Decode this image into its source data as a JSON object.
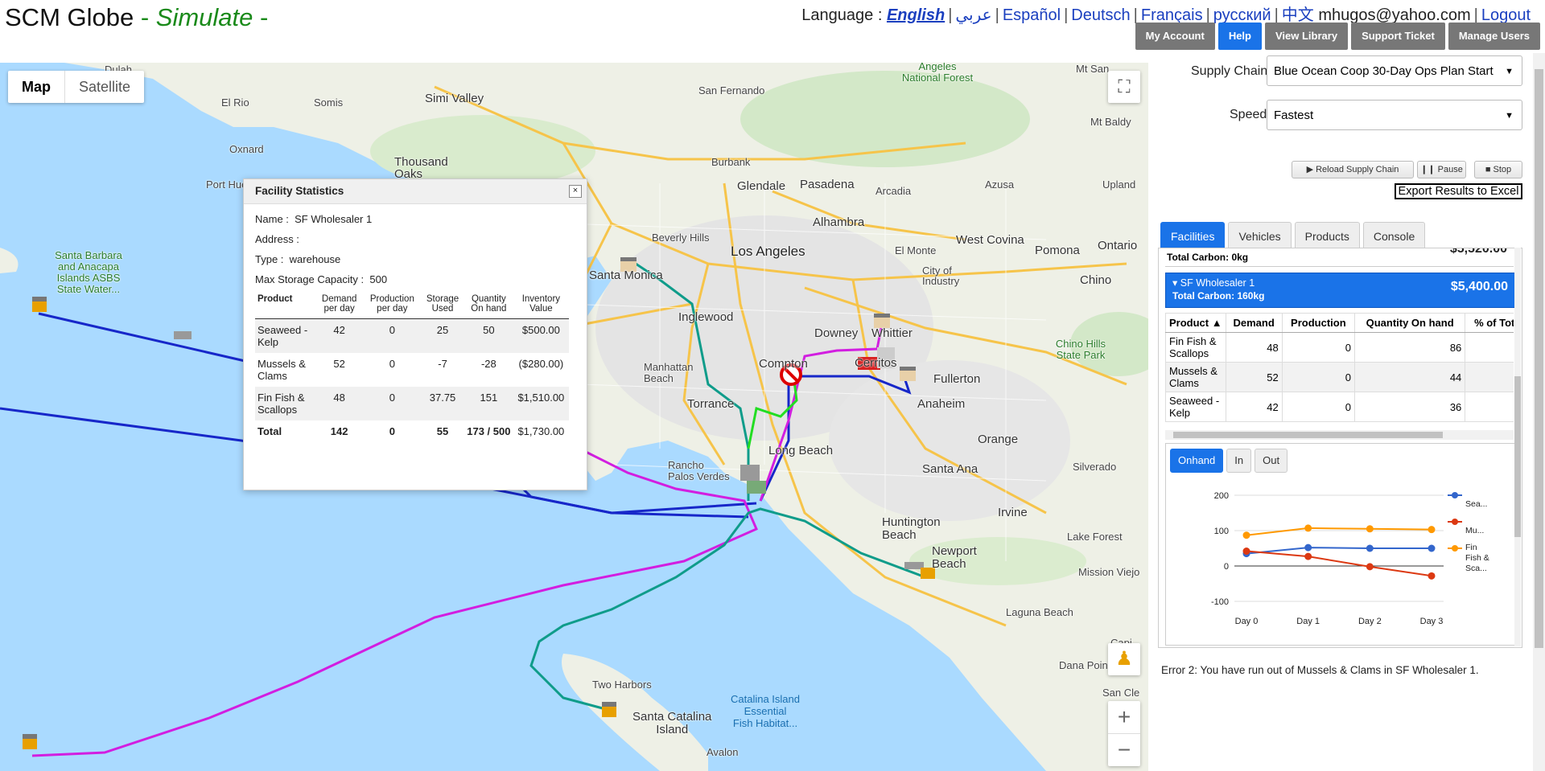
{
  "header": {
    "app_name": "SCM Globe",
    "mode_prefix": " - ",
    "mode": "Simulate",
    "mode_suffix": " -"
  },
  "language_bar": {
    "label": "Language :",
    "languages": [
      "English",
      "عربي",
      "Español",
      "Deutsch",
      "Français",
      "русский",
      "中文"
    ],
    "active": "English",
    "user_email": "mhugos@yahoo.com",
    "logout": "Logout"
  },
  "top_buttons": [
    "My Account",
    "Help",
    "View Library",
    "Support Ticket",
    "Manage Users"
  ],
  "map": {
    "type_buttons": [
      "Map",
      "Satellite"
    ],
    "labels": {
      "dulah": "Dulah",
      "el_rio": "El Rio",
      "somis": "Somis",
      "oxnard": "Oxnard",
      "simi_valley": "Simi Valley",
      "san_fernando": "San Fernando",
      "angeles_nf": "Angeles\nNational Forest",
      "mt_san": "Mt San",
      "mt_baldy": "Mt Baldy",
      "thousand_oaks": "Thousand\nOaks",
      "burbank": "Burbank",
      "port_hueneme": "Port Hueneme",
      "glendale": "Glendale",
      "pasadena": "Pasadena",
      "arcadia": "Arcadia",
      "azusa": "Azusa",
      "upland": "Upland",
      "alhambra": "Alhambra",
      "west_covina": "West Covina",
      "ontario": "Ontario",
      "beverly_hills": "Beverly Hills",
      "los_angeles": "Los Angeles",
      "el_monte": "El Monte",
      "pomona": "Pomona",
      "santa_monica": "Santa Monica",
      "city_of_industry": "City of\nIndustry",
      "santa_barbara": "Santa Barbara\nand Anacapa\nIslands ASBS\nState Water...",
      "chino": "Chino",
      "inglewood": "Inglewood",
      "whittier": "Whittier",
      "downey": "Downey",
      "chino_hills": "Chino Hills\nState Park",
      "compton": "Compton",
      "manhattan_beach": "Manhattan\nBeach",
      "cerritos": "Cerritos",
      "fullerton": "Fullerton",
      "torrance": "Torrance",
      "anaheim": "Anaheim",
      "orange": "Orange",
      "long_beach": "Long Beach",
      "rancho_palos_verdes": "Rancho\nPalos Verdes",
      "santa_ana": "Santa Ana",
      "silverado": "Silverado",
      "huntington_beach": "Huntington\nBeach",
      "irvine": "Irvine",
      "lake_forest": "Lake Forest",
      "newport_beach": "Newport\nBeach",
      "mission_viejo": "Mission Viejo",
      "laguna_beach": "Laguna Beach",
      "two_harbors": "Two Harbors",
      "santa_catalina": "Santa Catalina\nIsland",
      "catalina_essential": "Catalina Island\nEssential\nFish Habitat...",
      "dana_point": "Dana Point",
      "san_cle": "San Cle",
      "avalon": "Avalon",
      "capi": "Capi"
    }
  },
  "facility_popup": {
    "title": "Facility Statistics",
    "close": "×",
    "name_label": "Name :",
    "name": "SF Wholesaler 1",
    "address_label": "Address :",
    "address": "",
    "type_label": "Type :",
    "type": "warehouse",
    "capacity_label": "Max Storage Capacity :",
    "capacity": "500",
    "columns": [
      "Product",
      "Demand per day",
      "Production per day",
      "Storage Used",
      "Quantity On hand",
      "Inventory Value"
    ],
    "rows": [
      [
        "Seaweed - Kelp",
        "42",
        "0",
        "25",
        "50",
        "$500.00"
      ],
      [
        "Mussels & Clams",
        "52",
        "0",
        "-7",
        "-28",
        "($280.00)"
      ],
      [
        "Fin Fish & Scallops",
        "48",
        "0",
        "37.75",
        "151",
        "$1,510.00"
      ]
    ],
    "total": [
      "Total",
      "142",
      "0",
      "55",
      "173 / 500",
      "$1,730.00"
    ]
  },
  "controls": {
    "supply_chain_label": "Supply Chain",
    "supply_chain_value": "Blue Ocean Coop 30-Day Ops Plan Start",
    "speed_label": "Speed",
    "speed_value": "Fastest",
    "reload": "▶ Reload Supply Chain",
    "pause": "❙❙ Pause",
    "stop": "■ Stop",
    "export": "Export Results to Excel"
  },
  "tabs": [
    "Facilities",
    "Vehicles",
    "Products",
    "Console"
  ],
  "facility_list": {
    "prev_carbon": "Total Carbon: 0kg",
    "prev_value": "$5,520.00",
    "selected_name": "▾ SF Wholesaler 1",
    "selected_carbon": "Total Carbon: 160kg",
    "selected_value": "$5,400.00"
  },
  "product_table": {
    "columns": [
      "Product ▲",
      "Demand",
      "Production",
      "Quantity On hand",
      "% of Total C"
    ],
    "rows": [
      [
        "Fin Fish & Scallops",
        "48",
        "0",
        "86",
        ""
      ],
      [
        "Mussels & Clams",
        "52",
        "0",
        "44",
        ""
      ],
      [
        "Seaweed - Kelp",
        "42",
        "0",
        "36",
        ""
      ]
    ]
  },
  "chart_tabs": [
    "Onhand",
    "In",
    "Out"
  ],
  "chart_data": {
    "type": "line",
    "categories": [
      "Day 0",
      "Day 1",
      "Day 2",
      "Day 3"
    ],
    "y_ticks": [
      -100,
      0,
      100,
      200
    ],
    "ylim": [
      -100,
      200
    ],
    "series": [
      {
        "name": "Sea...",
        "legend_lines": [
          "Sea..."
        ],
        "color": "#3366cc",
        "values": [
          35,
          52,
          50,
          50
        ]
      },
      {
        "name": "Mu...",
        "legend_lines": [
          "Mu..."
        ],
        "color": "#dc3912",
        "values": [
          42,
          27,
          -2,
          -28
        ]
      },
      {
        "name": "Fin Fish & Sca...",
        "legend_lines": [
          "Fin",
          "Fish &",
          "Sca..."
        ],
        "color": "#ff9900",
        "values": [
          87,
          107,
          105,
          103
        ]
      }
    ]
  },
  "error_message": "Error 2: You have run out of Mussels & Clams in SF Wholesaler 1."
}
